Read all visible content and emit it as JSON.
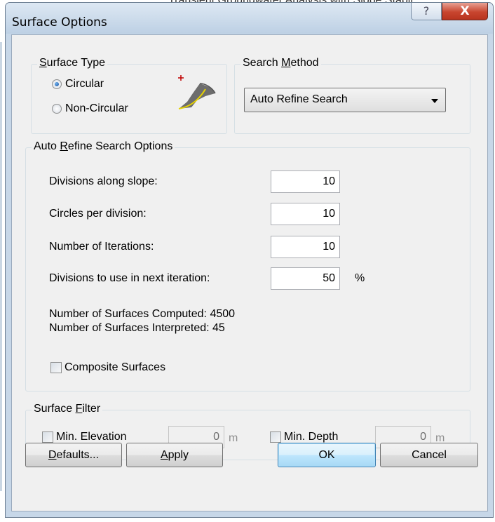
{
  "background_title": "Transient Groundwater Analysis with Slope Stabil",
  "window": {
    "title": "Surface Options",
    "help_glyph": "?",
    "close_glyph": "X"
  },
  "surface_type": {
    "label_pre": "",
    "label_accel": "S",
    "label_post": "urface Type",
    "options": [
      {
        "label": "Circular",
        "checked": true
      },
      {
        "label": "Non-Circular",
        "checked": false
      }
    ],
    "icon": "circular-slip-surface-icon"
  },
  "search_method": {
    "label_pre": "Search ",
    "label_accel": "M",
    "label_post": "ethod",
    "selected": "Auto Refine Search"
  },
  "auto_refine": {
    "label_pre": "Auto ",
    "label_accel": "R",
    "label_post": "efine Search Options",
    "rows": [
      {
        "label": "Divisions along slope:",
        "value": "10"
      },
      {
        "label": "Circles per division:",
        "value": "10"
      },
      {
        "label": "Number of Iterations:",
        "value": "10"
      },
      {
        "label": "Divisions to use in next iteration:",
        "value": "50"
      }
    ],
    "percent_unit": "%",
    "computed": "Number of Surfaces Computed: 4500",
    "interpreted": "Number of Surfaces Interpreted: 45",
    "composite_label": "Composite Surfaces",
    "composite_checked": false
  },
  "surface_filter": {
    "label_pre": "Surface ",
    "label_accel": "F",
    "label_post": "ilter",
    "min_elevation": {
      "label": "Min. Elevation",
      "value": "0",
      "unit": "m",
      "checked": false
    },
    "min_depth": {
      "label": "Min. Depth",
      "value": "0",
      "unit": "m",
      "checked": false
    }
  },
  "buttons": {
    "defaults": {
      "pre": "",
      "accel": "D",
      "post": "efaults..."
    },
    "apply": {
      "pre": "",
      "accel": "A",
      "post": "pply"
    },
    "ok": "OK",
    "cancel": "Cancel"
  },
  "colors": {
    "window_frame": "#c7d7e8",
    "dialog_bg": "#f0f0f0",
    "close_button": "#c8452f",
    "radio_selected": "#1a4f9e"
  }
}
